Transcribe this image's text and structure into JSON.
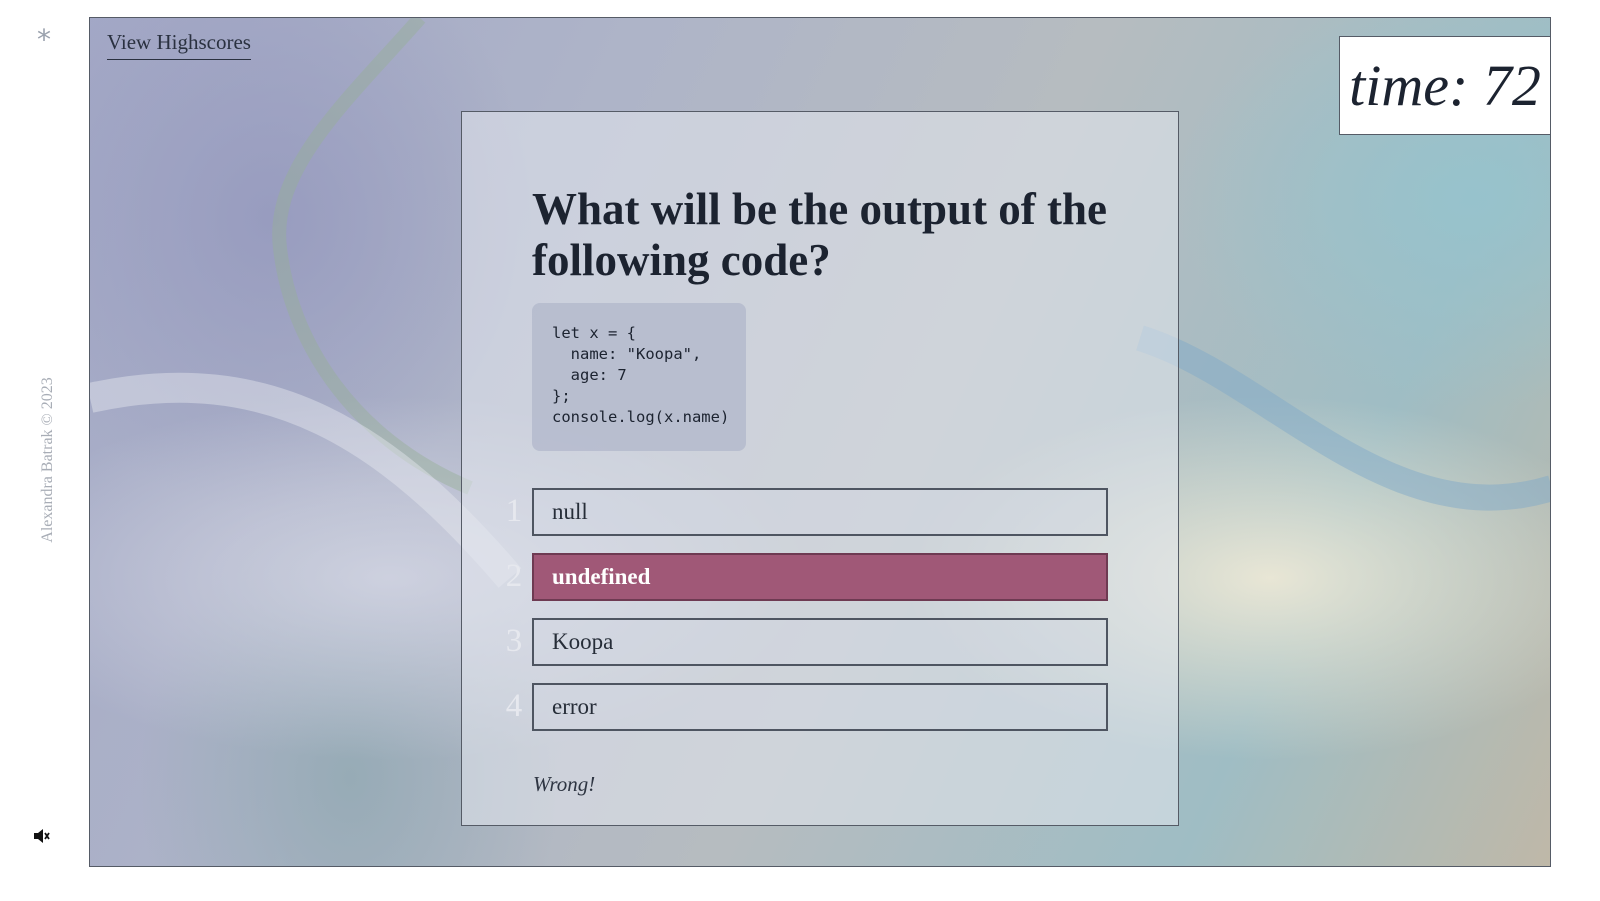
{
  "sidebar": {
    "asterisk": "*",
    "copyright": "Alexandra Batrak © 2023",
    "sound_icon": "speaker-mute-icon"
  },
  "header": {
    "highscores_link": "View Highscores",
    "timer": "time: 72"
  },
  "quiz": {
    "question": "What will be the output of the following code?",
    "code": "let x = {\n  name: \"Koopa\",\n  age: 7\n};\nconsole.log(x.name)",
    "answers": [
      {
        "number": "1",
        "label": "null"
      },
      {
        "number": "2",
        "label": "undefined",
        "selected": true
      },
      {
        "number": "3",
        "label": "Koopa"
      },
      {
        "number": "4",
        "label": "error"
      }
    ],
    "feedback": "Wrong!"
  },
  "colors": {
    "selected_answer": "#a05877",
    "border": "#555b66"
  }
}
